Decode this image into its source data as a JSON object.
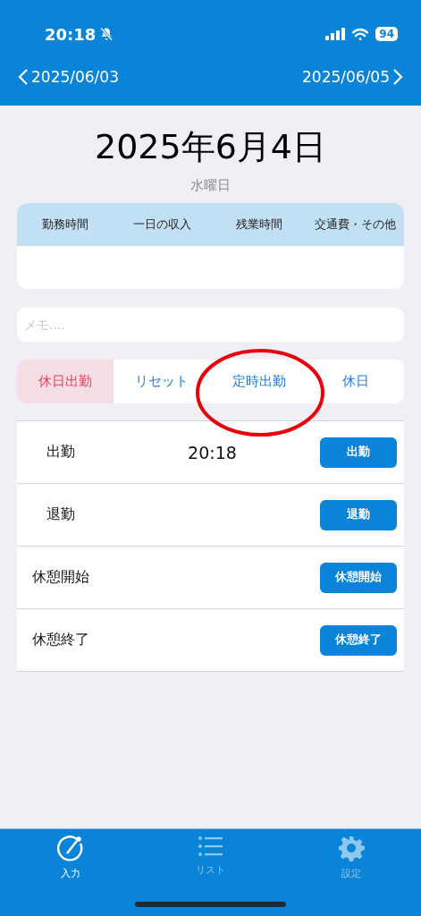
{
  "status_bar": {
    "time": "20:18",
    "battery": "94"
  },
  "nav": {
    "prev": "2025/06/03",
    "next": "2025/06/05"
  },
  "date_title": "2025年6月4日",
  "weekday": "水曜日",
  "summary": {
    "columns": [
      "勤務時間",
      "一日の収入",
      "残業時間",
      "交通費・その他"
    ]
  },
  "memo": {
    "placeholder": "メモ...."
  },
  "segments": [
    {
      "label": "休日出勤",
      "selected": true
    },
    {
      "label": "リセット",
      "selected": false
    },
    {
      "label": "定時出勤",
      "selected": false
    },
    {
      "label": "休日",
      "selected": false
    }
  ],
  "rows": [
    {
      "label": "出勤",
      "time": "20:18",
      "button": "出勤"
    },
    {
      "label": "退勤",
      "button": "退勤"
    },
    {
      "label": "休憩開始",
      "button": "休憩開始"
    },
    {
      "label": "休憩終了",
      "button": "休憩終了"
    }
  ],
  "tab_bar": [
    {
      "label": "入力",
      "kind": "input",
      "selected": true
    },
    {
      "label": "リスト",
      "kind": "list",
      "selected": false
    },
    {
      "label": "設定",
      "kind": "settings",
      "selected": false
    }
  ]
}
